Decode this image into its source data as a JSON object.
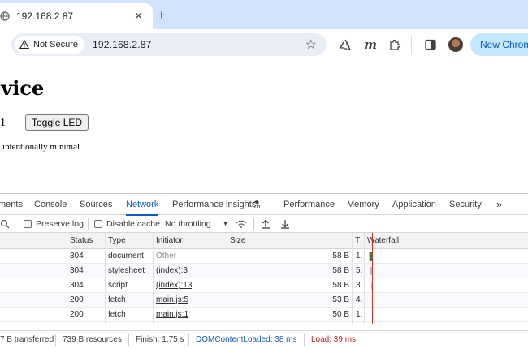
{
  "browser": {
    "tab_title": "192.168.2.87",
    "tab_close": "✕",
    "new_tab": "+",
    "security_chip": "Not Secure",
    "url": "192.168.2.87",
    "new_chrome_label": "New Chrome",
    "icons": [
      "globe-icon",
      "warning-icon",
      "star-icon",
      "recycle-icon",
      "m-extension-icon",
      "puzzle-icon",
      "side-panel-icon",
      "profile-avatar"
    ]
  },
  "page": {
    "title": "evice",
    "led_state": "1",
    "toggle_button": "Toggle LED",
    "note": "s intentionally minimal"
  },
  "devtools": {
    "tabs": [
      {
        "label": "ments"
      },
      {
        "label": "Console"
      },
      {
        "label": "Sources"
      },
      {
        "label": "Network",
        "active": true
      },
      {
        "label": "Performance insights"
      },
      {
        "label": "Performance"
      },
      {
        "label": "Memory"
      },
      {
        "label": "Application"
      },
      {
        "label": "Security"
      },
      {
        "label": "»"
      }
    ],
    "filter": {
      "preserve_log": "Preserve log",
      "disable_cache": "Disable cache",
      "throttling": "No throttling"
    },
    "columns": {
      "status": "Status",
      "type": "Type",
      "initiator": "Initiator",
      "size": "Size",
      "time": "T",
      "waterfall": "Waterfall"
    },
    "rows": [
      {
        "status": "304",
        "type": "document",
        "initiator": "Other",
        "size": "58 B",
        "time": "1."
      },
      {
        "status": "304",
        "type": "stylesheet",
        "initiator": "(index):3",
        "size": "58 B",
        "time": "5."
      },
      {
        "status": "304",
        "type": "script",
        "initiator": "(index):13",
        "size": "58 B",
        "time": "3."
      },
      {
        "status": "200",
        "type": "fetch",
        "initiator": "main.js:5",
        "size": "53 B",
        "time": "4."
      },
      {
        "status": "200",
        "type": "fetch",
        "initiator": "main.js:1",
        "size": "50 B",
        "time": "1."
      }
    ],
    "status_bar": {
      "transferred": "7 B transferred",
      "resources": "739 B resources",
      "finish": "Finish: 1.75 s",
      "dom_loaded": "DOMContentLoaded: 38 ms",
      "load": "Load: 39 ms"
    },
    "colors": {
      "accent": "#0b57d0",
      "dom_line": "#1a73e8",
      "load_line": "#d93025"
    }
  }
}
